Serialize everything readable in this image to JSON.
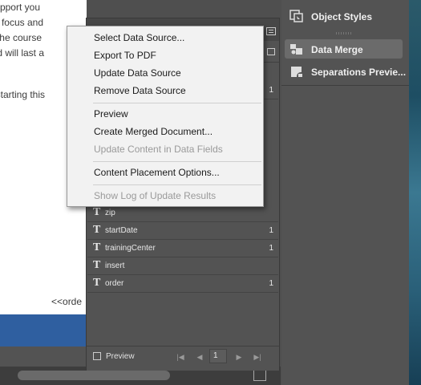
{
  "document": {
    "lines": [
      "pport you",
      "focus and",
      "he course",
      "d will last a",
      "starting this"
    ],
    "tag": "<<orde"
  },
  "context_menu": {
    "group1": [
      "Select Data Source...",
      "Export To PDF",
      "Update Data Source",
      "Remove Data Source"
    ],
    "group2": [
      "Preview",
      "Create Merged Document...",
      "Update Content in Data Fields"
    ],
    "group3": [
      "Content Placement Options..."
    ],
    "group4": [
      "Show Log of Update Results"
    ],
    "disabled": [
      "Update Content in Data Fields",
      "Show Log of Update Results"
    ]
  },
  "data_merge": {
    "fields": [
      {
        "name": "zip",
        "count": ""
      },
      {
        "name": "startDate",
        "count": "1"
      },
      {
        "name": "trainingCenter",
        "count": "1"
      },
      {
        "name": "insert",
        "count": ""
      },
      {
        "name": "order",
        "count": "1"
      }
    ],
    "partial_count": "1",
    "field_type_glyph": "T",
    "footer": {
      "preview_label": "Preview",
      "page_number": "1"
    }
  },
  "right_panel": {
    "items": [
      {
        "label": "Object Styles",
        "icon": "object-styles-icon",
        "selected": false
      },
      {
        "label": "Data Merge",
        "icon": "data-merge-icon",
        "selected": true
      },
      {
        "label": "Separations Previe...",
        "icon": "separations-preview-icon",
        "selected": false
      }
    ]
  },
  "colors": {
    "accent_blue": "#2f5fa0",
    "panel": "#535353",
    "menu": "#f2f2f2"
  }
}
